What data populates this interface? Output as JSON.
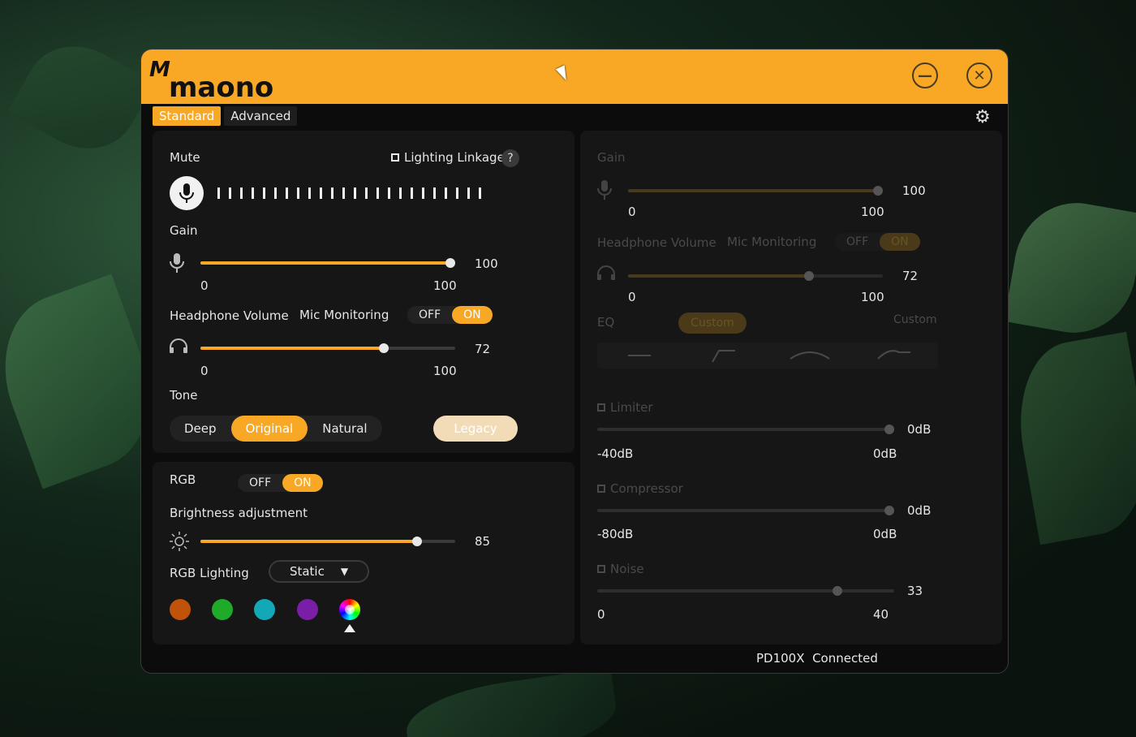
{
  "brand": {
    "name": "maono"
  },
  "window": {
    "minimize_icon": "minimize-circle-icon",
    "close_icon": "close-circle-icon"
  },
  "tabs": [
    {
      "label": "Standard",
      "active": true
    },
    {
      "label": "Advanced",
      "active": false
    }
  ],
  "settings_icon": "gear-icon",
  "mute": {
    "label": "Mute",
    "lighting_linkage": "Lighting Linkage",
    "help": "?"
  },
  "gain": {
    "label": "Gain",
    "value": 100,
    "min": "0",
    "max": "100",
    "value_text": "100"
  },
  "headphone": {
    "label": "Headphone Volume",
    "monitoring_label": "Mic Monitoring",
    "off": "OFF",
    "on": "ON",
    "value": 72,
    "value_text": "72",
    "min": "0",
    "max": "100"
  },
  "tone": {
    "label": "Tone",
    "options": [
      "Deep",
      "Original",
      "Natural"
    ],
    "selected": "Original",
    "legacy": "Legacy"
  },
  "rgb": {
    "label": "RGB",
    "off": "OFF",
    "on": "ON",
    "brightness_label": "Brightness adjustment",
    "brightness": 85,
    "brightness_text": "85",
    "lighting_label": "RGB Lighting",
    "mode": "Static",
    "colors": [
      "#c0520a",
      "#1faa2a",
      "#12a8b8",
      "#7a1ea8",
      "rainbow"
    ]
  },
  "advanced": {
    "gain": {
      "label": "Gain",
      "value_text": "100",
      "min": "0",
      "max": "100"
    },
    "headphone": {
      "label": "Headphone Volume",
      "monitoring_label": "Mic Monitoring",
      "off": "OFF",
      "on": "ON",
      "value_text": "72",
      "min": "0",
      "max": "100"
    },
    "eq": {
      "label": "EQ",
      "preset": "Custom",
      "preset_right": "Custom"
    },
    "limiter": {
      "label": "Limiter",
      "value_text": "0dB",
      "min": "-40dB",
      "max": "0dB"
    },
    "compressor": {
      "label": "Compressor",
      "value_text": "0dB",
      "min": "-80dB",
      "max": "0dB"
    },
    "noise": {
      "label": "Noise",
      "value_text": "33",
      "min": "0",
      "max": "40"
    }
  },
  "status": {
    "device": "PD100X",
    "state": "Connected"
  }
}
